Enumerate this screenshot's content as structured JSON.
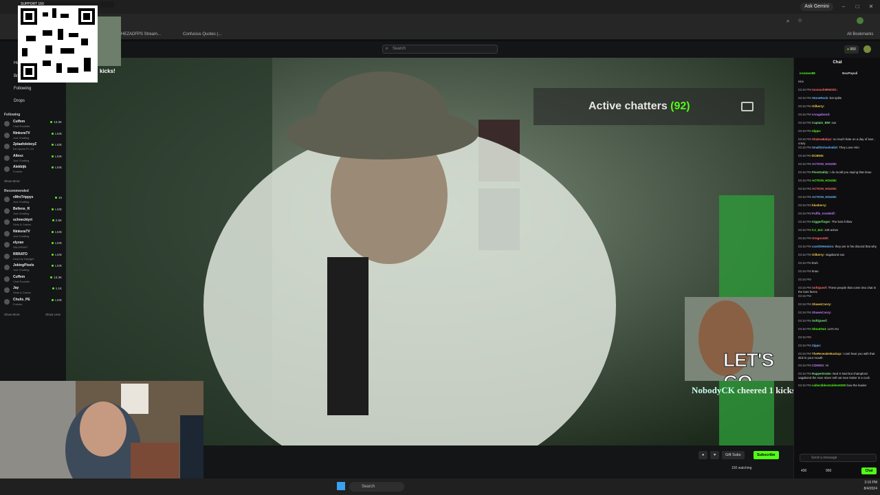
{
  "browser": {
    "ask_gemini": "Ask Gemini",
    "bookmarks": [
      "HEZADFPS Stream...",
      "Confucius Quotes (...",
      "All Bookmarks"
    ],
    "qr_label": "SUPPORT 150"
  },
  "site": {
    "search_placeholder": "Search",
    "points": "950"
  },
  "sidebar": {
    "nav": [
      "Home",
      "Browse",
      "Following",
      "Drops"
    ],
    "following_title": "Following",
    "following": [
      {
        "name": "Cuffem",
        "category": "Chat Roulette",
        "viewers": "13.3K"
      },
      {
        "name": "NinkeraTV",
        "category": "Just Chatting",
        "viewers": "LIVE"
      },
      {
        "name": "ZplaafoIoboyZ",
        "category": "EA Sports FC 24",
        "viewers": "LIVE"
      },
      {
        "name": "Ailesx",
        "category": "Just Chatting",
        "viewers": "LIVE"
      },
      {
        "name": "Alekktjk",
        "category": "Fortnite",
        "viewers": "LIVE"
      }
    ],
    "show_more": "Show More",
    "recommended_title": "Recommended",
    "recommended": [
      {
        "name": "xMrsTrippyx",
        "category": "Just Chatting",
        "viewers": "15"
      },
      {
        "name": "Bellens_R",
        "category": "Just Chatting",
        "viewers": "LIVE"
      },
      {
        "name": "schnecktyrt",
        "category": "Slots & Casino",
        "viewers": "2.5K"
      },
      {
        "name": "NinkeraTV",
        "category": "Just Chatting",
        "viewers": "LIVE"
      },
      {
        "name": "elyzao",
        "category": "VALORANT",
        "viewers": "LIVE"
      },
      {
        "name": "RRRATO",
        "category": "Dead by Daylight",
        "viewers": "LIVE"
      },
      {
        "name": "JokingPixels",
        "category": "Just Chatting",
        "viewers": "LIVE"
      },
      {
        "name": "Cuffem",
        "category": "Chat Roulette",
        "viewers": "13.3K"
      },
      {
        "name": "Jay",
        "category": "Slots & Casino",
        "viewers": "1.1K"
      },
      {
        "name": "Chulis_PE",
        "category": "Fortnite",
        "viewers": "LIVE"
      }
    ],
    "show_more_2": "Show More",
    "show_less": "Show Less"
  },
  "overlay": {
    "active_chatters_label": "Active chatters",
    "active_chatters_count": "(92)",
    "letsgo": "LET'S GO",
    "cheer_user": "NobodyCK",
    "cheer_text": "cheered",
    "cheer_amount": "1 kicks!",
    "qr_kicks": "kicks!"
  },
  "video_bar": {
    "gift_subs": "Gift Subs",
    "subscribe": "Subscribe",
    "watching": "150 watching"
  },
  "chat": {
    "header": "Chat",
    "pinned": [
      "ironmen88",
      "NoxPopuli"
    ],
    "messages": [
      {
        "ts": "",
        "user": "",
        "text": "nice"
      },
      {
        "ts": "03:16 PM",
        "user": "toomuch9992001:",
        "text": ""
      },
      {
        "ts": "03:16 PM",
        "user": "StoneRock:",
        "text": "bot spike"
      },
      {
        "ts": "03:16 PM",
        "user": "Oilberry:",
        "text": ""
      },
      {
        "ts": "03:16 PM",
        "user": "vrvagabond:",
        "text": ""
      },
      {
        "ts": "03:16 PM",
        "user": "Captain_BW:",
        "text": "sus"
      },
      {
        "ts": "03:16 PM",
        "user": "Zippo:",
        "text": ""
      },
      {
        "ts": "03:16 PM",
        "user": "ShakeaBabyz:",
        "text": "so much hate on a day of love . crazy"
      },
      {
        "ts": "03:16 PM",
        "user": "SmallSchoolsIdol:",
        "text": "They Love Him"
      },
      {
        "ts": "03:16 PM",
        "user": "DCBNN:",
        "text": ""
      },
      {
        "ts": "03:16 PM",
        "user": "ACTION_HOUSE:",
        "text": ""
      },
      {
        "ts": "03:16 PM",
        "user": "PiestZaddy:",
        "text": "i do recall you saying that imao"
      },
      {
        "ts": "03:16 PM",
        "user": "ACTION_HOUSE:",
        "text": ""
      },
      {
        "ts": "03:16 PM",
        "user": "ACTION_HOUSE:",
        "text": ""
      },
      {
        "ts": "03:16 PM",
        "user": "ACTION_HOUSE:",
        "text": ""
      },
      {
        "ts": "03:16 PM",
        "user": "blueberry:",
        "text": ""
      },
      {
        "ts": "03:16 PM",
        "user": "Puffin_IronWolf:",
        "text": ""
      },
      {
        "ts": "03:16 PM",
        "user": "triggerfinger:",
        "text": "The bots follow"
      },
      {
        "ts": "03:16 PM",
        "user": "CJ_412:",
        "text": "139 active"
      },
      {
        "ts": "03:16 PM",
        "user": "Oregon430:",
        "text": ""
      },
      {
        "ts": "03:16 PM",
        "user": "xxx0O0Hotsiro:",
        "text": "they are in his discord that why"
      },
      {
        "ts": "03:16 PM",
        "user": "Oilberry:",
        "text": "Vagabond sus"
      },
      {
        "ts": "03:16 PM",
        "user": "",
        "text": "bruh"
      },
      {
        "ts": "03:16 PM",
        "user": "",
        "text": "lmao"
      },
      {
        "ts": "03:16 PM",
        "user": "",
        "text": ""
      },
      {
        "ts": "03:16 PM",
        "user": "SoftQueef:",
        "text": "These people that come into chat in the bots farms"
      },
      {
        "ts": "03:16 PM",
        "user": "",
        "text": ""
      },
      {
        "ts": "03:16 PM",
        "user": "ShawnConry:",
        "text": ""
      },
      {
        "ts": "03:16 PM",
        "user": "ShawnConry:",
        "text": ""
      },
      {
        "ts": "03:16 PM",
        "user": "SoftQueef:",
        "text": ""
      },
      {
        "ts": "03:16 PM",
        "user": "ShoutOut:",
        "text": "Let's Go"
      },
      {
        "ts": "03:16 PM",
        "user": "",
        "text": ""
      },
      {
        "ts": "03:16 PM",
        "user": "Zippo:",
        "text": ""
      },
      {
        "ts": "03:16 PM",
        "user": "TheRevealerBackup:",
        "text": "I cant hear you with that dick in your mouth"
      },
      {
        "ts": "03:16 PM",
        "user": "CDN003:",
        "text": "Hi"
      },
      {
        "ts": "03:16 PM",
        "user": "RapperDrake:",
        "text": "Ned X Ned bot champlonz vagabond the race mixer sell out race traitor is a cuck"
      },
      {
        "ts": "03:16 PM",
        "user": "collectiblesGoldenKEW",
        "text": "bow the leader"
      }
    ],
    "input_placeholder": "Send a message",
    "footer_count": "430",
    "footer_points": "950",
    "chat_button": "Chat"
  },
  "taskbar": {
    "search": "Search",
    "time": "3:16 PM",
    "date": "8/4/2024"
  }
}
